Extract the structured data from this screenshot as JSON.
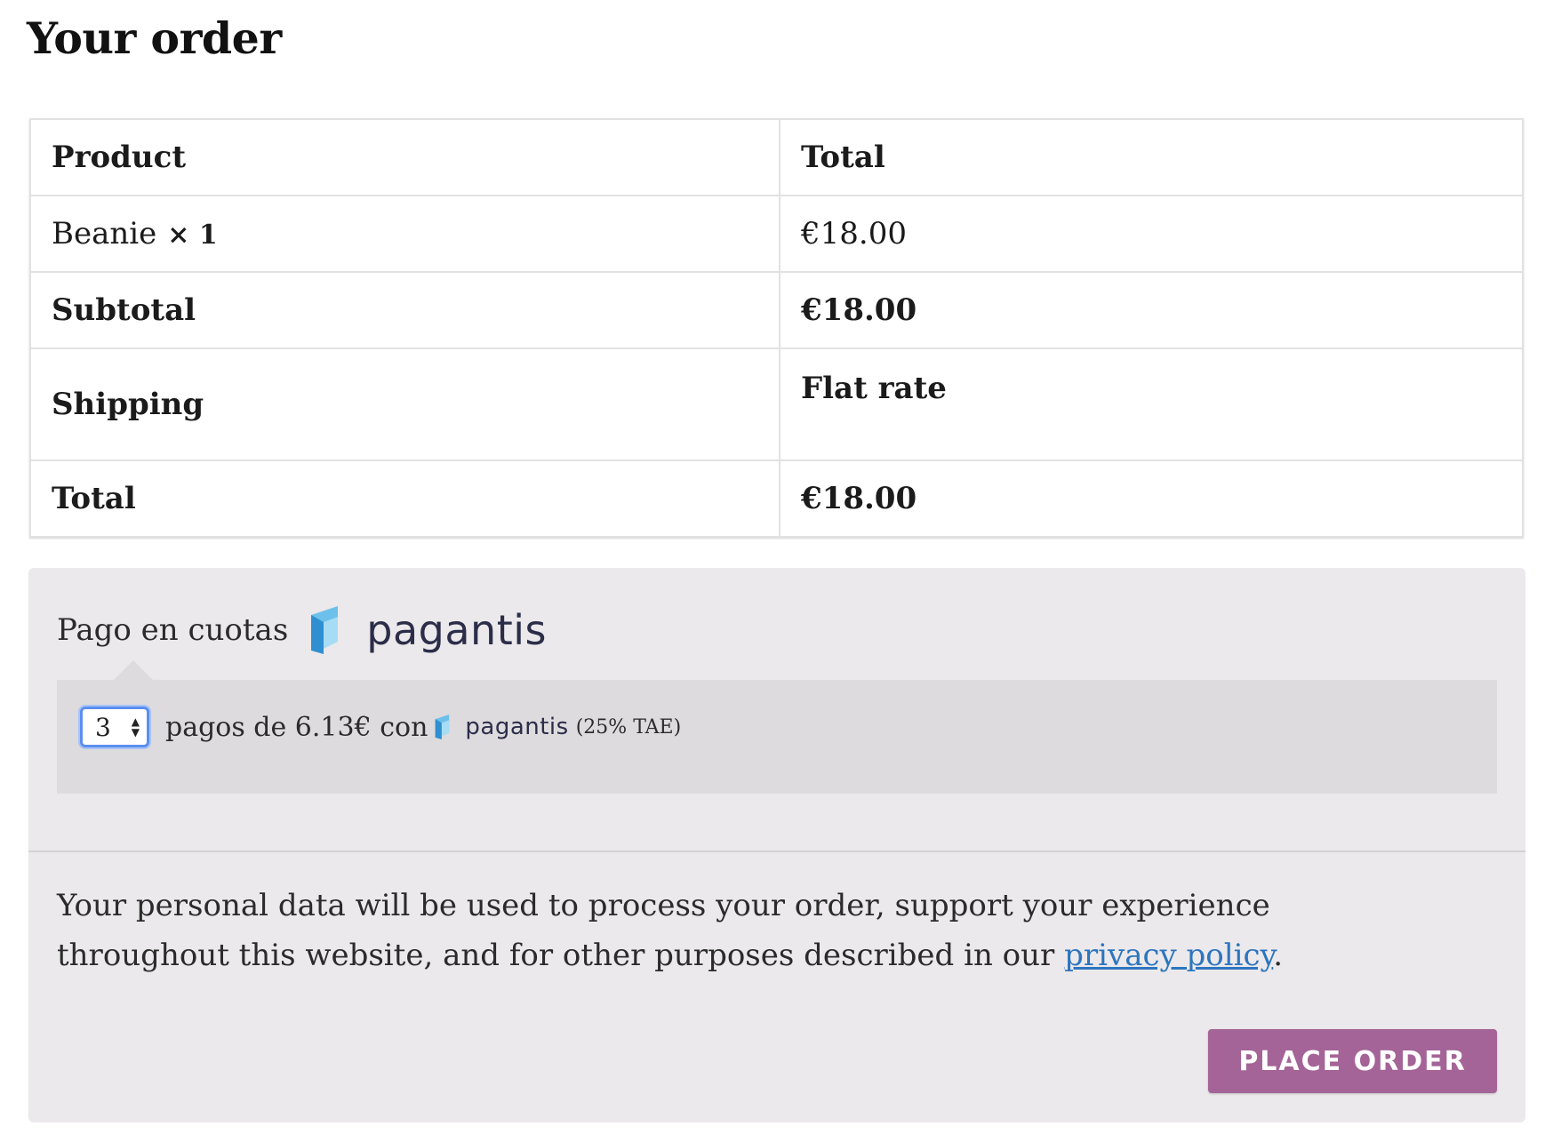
{
  "heading": "Your order",
  "table": {
    "headers": [
      "Product",
      "Total"
    ],
    "product": {
      "name": "Beanie",
      "qty": "× 1",
      "total": "€18.00"
    },
    "subtotal": {
      "label": "Subtotal",
      "value": "€18.00"
    },
    "shipping": {
      "label": "Shipping",
      "value": "Flat rate"
    },
    "total": {
      "label": "Total",
      "value": "€18.00"
    }
  },
  "payment": {
    "method_label": "Pago en cuotas",
    "brand": "pagantis",
    "installments_selected": "3",
    "installment_text": "pagos de 6.13€ con",
    "tae": "(25% TAE)"
  },
  "privacy": {
    "text_before": "Your personal data will be used to process your order, support your experience throughout this website, and for other purposes described in our ",
    "link_text": "privacy policy",
    "text_after": "."
  },
  "place_order_label": "PLACE ORDER",
  "colors": {
    "button": "#a46497",
    "link": "#2d75bf",
    "panel": "#ebe9eb",
    "logo_blue": "#4a9fd8"
  },
  "icons": {
    "logo": "pagantis-logo-icon",
    "select_arrows": "select-arrows-icon"
  }
}
